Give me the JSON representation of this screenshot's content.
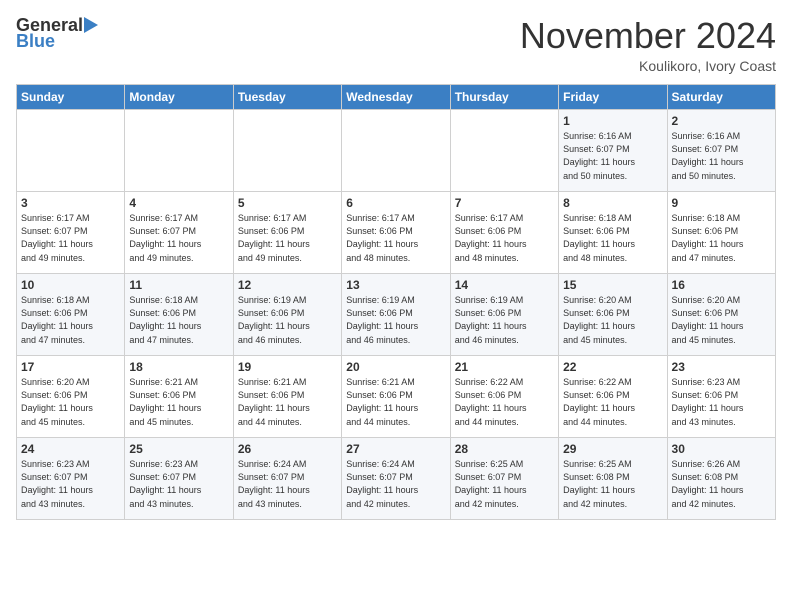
{
  "logo": {
    "general": "General",
    "blue": "Blue"
  },
  "title": "November 2024",
  "subtitle": "Koulikoro, Ivory Coast",
  "days_header": [
    "Sunday",
    "Monday",
    "Tuesday",
    "Wednesday",
    "Thursday",
    "Friday",
    "Saturday"
  ],
  "weeks": [
    [
      {
        "day": "",
        "info": ""
      },
      {
        "day": "",
        "info": ""
      },
      {
        "day": "",
        "info": ""
      },
      {
        "day": "",
        "info": ""
      },
      {
        "day": "",
        "info": ""
      },
      {
        "day": "1",
        "info": "Sunrise: 6:16 AM\nSunset: 6:07 PM\nDaylight: 11 hours\nand 50 minutes."
      },
      {
        "day": "2",
        "info": "Sunrise: 6:16 AM\nSunset: 6:07 PM\nDaylight: 11 hours\nand 50 minutes."
      }
    ],
    [
      {
        "day": "3",
        "info": "Sunrise: 6:17 AM\nSunset: 6:07 PM\nDaylight: 11 hours\nand 49 minutes."
      },
      {
        "day": "4",
        "info": "Sunrise: 6:17 AM\nSunset: 6:07 PM\nDaylight: 11 hours\nand 49 minutes."
      },
      {
        "day": "5",
        "info": "Sunrise: 6:17 AM\nSunset: 6:06 PM\nDaylight: 11 hours\nand 49 minutes."
      },
      {
        "day": "6",
        "info": "Sunrise: 6:17 AM\nSunset: 6:06 PM\nDaylight: 11 hours\nand 48 minutes."
      },
      {
        "day": "7",
        "info": "Sunrise: 6:17 AM\nSunset: 6:06 PM\nDaylight: 11 hours\nand 48 minutes."
      },
      {
        "day": "8",
        "info": "Sunrise: 6:18 AM\nSunset: 6:06 PM\nDaylight: 11 hours\nand 48 minutes."
      },
      {
        "day": "9",
        "info": "Sunrise: 6:18 AM\nSunset: 6:06 PM\nDaylight: 11 hours\nand 47 minutes."
      }
    ],
    [
      {
        "day": "10",
        "info": "Sunrise: 6:18 AM\nSunset: 6:06 PM\nDaylight: 11 hours\nand 47 minutes."
      },
      {
        "day": "11",
        "info": "Sunrise: 6:18 AM\nSunset: 6:06 PM\nDaylight: 11 hours\nand 47 minutes."
      },
      {
        "day": "12",
        "info": "Sunrise: 6:19 AM\nSunset: 6:06 PM\nDaylight: 11 hours\nand 46 minutes."
      },
      {
        "day": "13",
        "info": "Sunrise: 6:19 AM\nSunset: 6:06 PM\nDaylight: 11 hours\nand 46 minutes."
      },
      {
        "day": "14",
        "info": "Sunrise: 6:19 AM\nSunset: 6:06 PM\nDaylight: 11 hours\nand 46 minutes."
      },
      {
        "day": "15",
        "info": "Sunrise: 6:20 AM\nSunset: 6:06 PM\nDaylight: 11 hours\nand 45 minutes."
      },
      {
        "day": "16",
        "info": "Sunrise: 6:20 AM\nSunset: 6:06 PM\nDaylight: 11 hours\nand 45 minutes."
      }
    ],
    [
      {
        "day": "17",
        "info": "Sunrise: 6:20 AM\nSunset: 6:06 PM\nDaylight: 11 hours\nand 45 minutes."
      },
      {
        "day": "18",
        "info": "Sunrise: 6:21 AM\nSunset: 6:06 PM\nDaylight: 11 hours\nand 45 minutes."
      },
      {
        "day": "19",
        "info": "Sunrise: 6:21 AM\nSunset: 6:06 PM\nDaylight: 11 hours\nand 44 minutes."
      },
      {
        "day": "20",
        "info": "Sunrise: 6:21 AM\nSunset: 6:06 PM\nDaylight: 11 hours\nand 44 minutes."
      },
      {
        "day": "21",
        "info": "Sunrise: 6:22 AM\nSunset: 6:06 PM\nDaylight: 11 hours\nand 44 minutes."
      },
      {
        "day": "22",
        "info": "Sunrise: 6:22 AM\nSunset: 6:06 PM\nDaylight: 11 hours\nand 44 minutes."
      },
      {
        "day": "23",
        "info": "Sunrise: 6:23 AM\nSunset: 6:06 PM\nDaylight: 11 hours\nand 43 minutes."
      }
    ],
    [
      {
        "day": "24",
        "info": "Sunrise: 6:23 AM\nSunset: 6:07 PM\nDaylight: 11 hours\nand 43 minutes."
      },
      {
        "day": "25",
        "info": "Sunrise: 6:23 AM\nSunset: 6:07 PM\nDaylight: 11 hours\nand 43 minutes."
      },
      {
        "day": "26",
        "info": "Sunrise: 6:24 AM\nSunset: 6:07 PM\nDaylight: 11 hours\nand 43 minutes."
      },
      {
        "day": "27",
        "info": "Sunrise: 6:24 AM\nSunset: 6:07 PM\nDaylight: 11 hours\nand 42 minutes."
      },
      {
        "day": "28",
        "info": "Sunrise: 6:25 AM\nSunset: 6:07 PM\nDaylight: 11 hours\nand 42 minutes."
      },
      {
        "day": "29",
        "info": "Sunrise: 6:25 AM\nSunset: 6:08 PM\nDaylight: 11 hours\nand 42 minutes."
      },
      {
        "day": "30",
        "info": "Sunrise: 6:26 AM\nSunset: 6:08 PM\nDaylight: 11 hours\nand 42 minutes."
      }
    ]
  ]
}
